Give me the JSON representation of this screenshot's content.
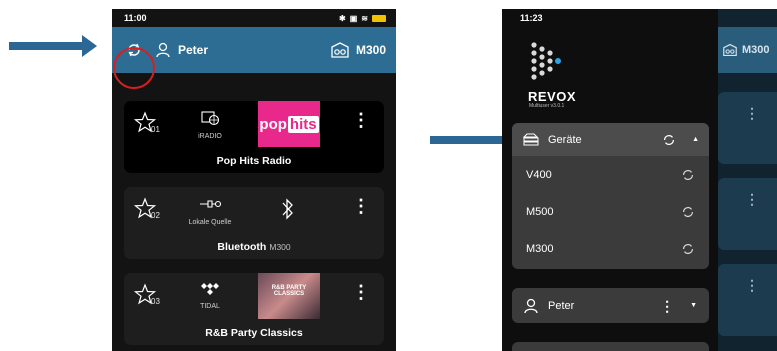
{
  "left_phone": {
    "status_time": "11:00",
    "user_name": "Peter",
    "device_name": "M300",
    "favorites": [
      {
        "number": "01",
        "source_label": "iRADIO",
        "title": "Pop Hits Radio",
        "subtitle": "",
        "cover_text_a": "pop",
        "cover_text_b": "hits"
      },
      {
        "number": "02",
        "source_label": "Lokale Quelle",
        "title": "Bluetooth",
        "subtitle": "M300"
      },
      {
        "number": "03",
        "source_label": "TIDAL",
        "title": "R&B Party Classics",
        "subtitle": "",
        "cover_text": "R&B PARTY CLASSICS"
      }
    ]
  },
  "right_phone": {
    "status_time": "11:23",
    "logo_text": "REVOX",
    "logo_sub": "Multiuser v3.0.1",
    "devices_label": "Geräte",
    "devices": [
      "V400",
      "M500",
      "M300"
    ],
    "user_name": "Peter",
    "behind_device_name": "M300"
  },
  "colors": {
    "accent": "#2d6d93",
    "arrow": "#2c6694",
    "highlight_circle": "#d61f1f",
    "pop_hits": "#e8288a",
    "logo_dot": "#2aa4e8"
  }
}
